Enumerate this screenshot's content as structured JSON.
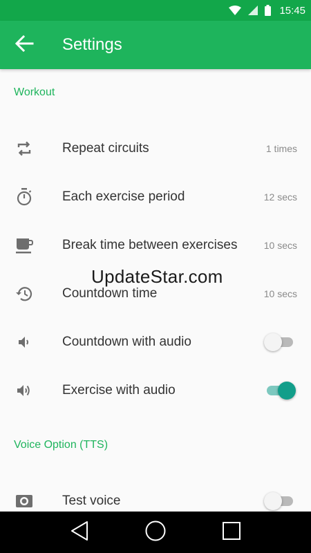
{
  "status_bar": {
    "time": "15:45",
    "icons": [
      "wifi-icon",
      "cell-signal-icon",
      "battery-icon"
    ]
  },
  "app_bar": {
    "title": "Settings",
    "back_icon": "arrow-left-icon"
  },
  "sections": {
    "workout": {
      "header": "Workout",
      "items": [
        {
          "icon": "repeat-icon",
          "label": "Repeat circuits",
          "value": "1 times"
        },
        {
          "icon": "stopwatch-icon",
          "label": "Each exercise period",
          "value": "12 secs"
        },
        {
          "icon": "coffee-cup-icon",
          "label": "Break time between exercises",
          "value": "10 secs"
        },
        {
          "icon": "history-icon",
          "label": "Countdown time",
          "value": "10 secs"
        },
        {
          "icon": "volume-low-icon",
          "label": "Countdown with audio",
          "toggle": false
        },
        {
          "icon": "volume-high-icon",
          "label": "Exercise with audio",
          "toggle": true
        }
      ]
    },
    "voice": {
      "header": "Voice Option (TTS)",
      "items": [
        {
          "icon": "speaker-icon",
          "label": "Test voice",
          "toggle": false
        }
      ]
    }
  },
  "watermark": "UpdateStar.com",
  "colors": {
    "status_bar": "#12a74a",
    "app_bar": "#1eb45c",
    "accent": "#1eb45c",
    "toggle_on": "#129e8a"
  },
  "nav_bar": {
    "icons": [
      "back-triangle-icon",
      "home-circle-icon",
      "recents-square-icon"
    ]
  }
}
